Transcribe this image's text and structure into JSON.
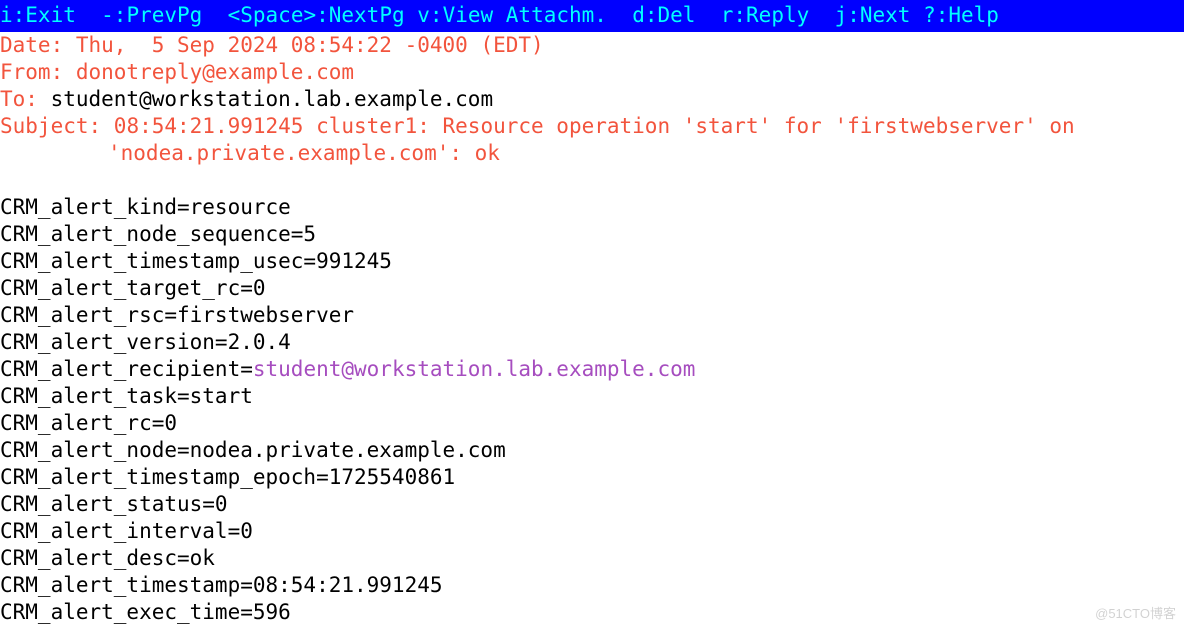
{
  "menubar": {
    "exit": "i:Exit",
    "prev": "-:PrevPg",
    "next": "<Space>:NextPg",
    "view": "v:View Attachm.",
    "del": "d:Del",
    "reply": "r:Reply",
    "jnext": "j:Next",
    "help": "?:Help"
  },
  "headers": {
    "date_label": "Date: ",
    "date_value": "Thu,  5 Sep 2024 08:54:22 -0400 (EDT)",
    "from_label": "From: ",
    "from_value": "donotreply@example.com",
    "to_label": "To: ",
    "to_value": "student@workstation.lab.example.com",
    "subject_label": "Subject: ",
    "subject_line1": "08:54:21.991245 cluster1: Resource operation 'start' for 'firstwebserver' on",
    "subject_line2": "'nodea.private.example.com': ok"
  },
  "body": {
    "l01": "CRM_alert_kind=resource",
    "l02": "CRM_alert_node_sequence=5",
    "l03": "CRM_alert_timestamp_usec=991245",
    "l04": "CRM_alert_target_rc=0",
    "l05": "CRM_alert_rsc=firstwebserver",
    "l06": "CRM_alert_version=2.0.4",
    "l07_pre": "CRM_alert_recipient=",
    "l07_link": "student@workstation.lab.example.com",
    "l08": "CRM_alert_task=start",
    "l09": "CRM_alert_rc=0",
    "l10": "CRM_alert_node=nodea.private.example.com",
    "l11": "CRM_alert_timestamp_epoch=1725540861",
    "l12": "CRM_alert_status=0",
    "l13": "CRM_alert_interval=0",
    "l14": "CRM_alert_desc=ok",
    "l15": "CRM_alert_timestamp=08:54:21.991245",
    "l16": "CRM_alert_exec_time=596"
  },
  "watermark": "@51CTO博客"
}
